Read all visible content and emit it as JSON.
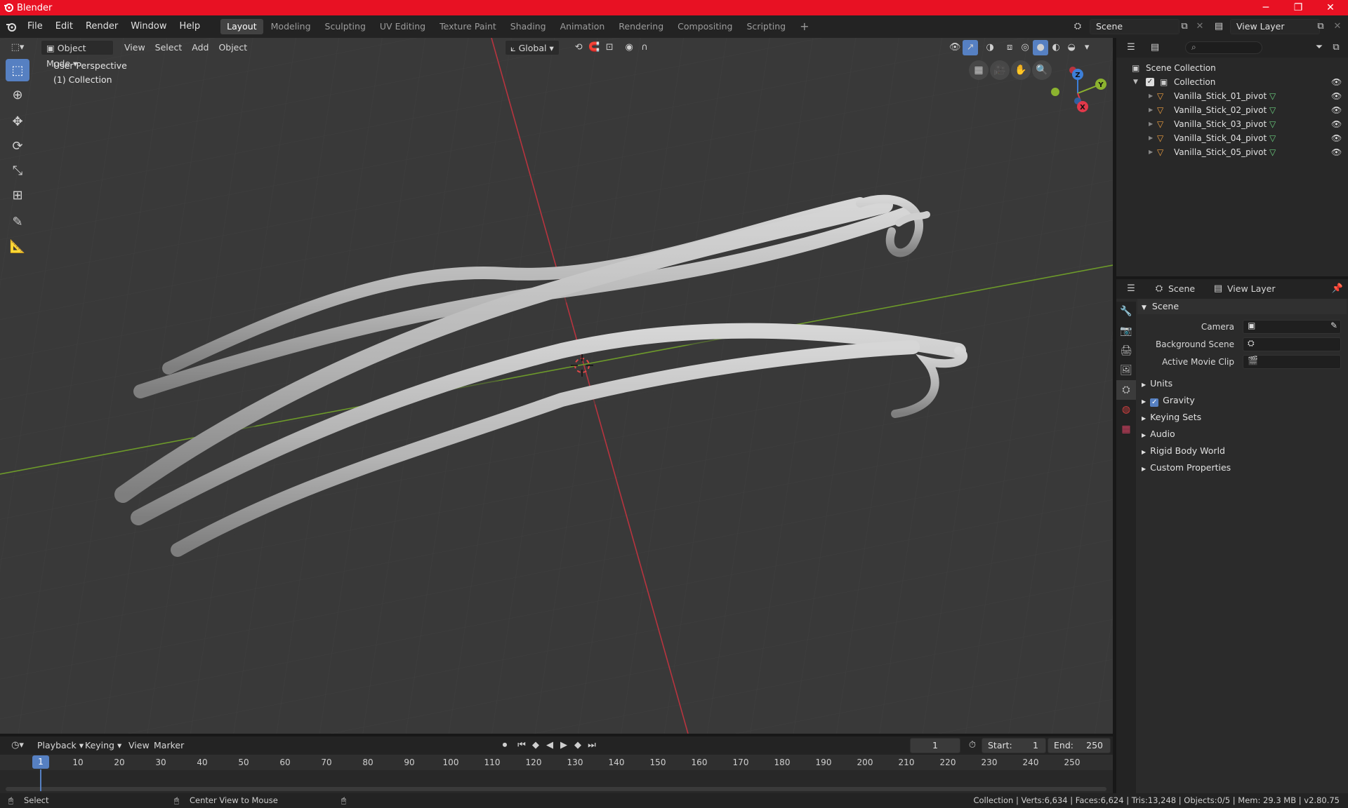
{
  "app": {
    "title": "Blender"
  },
  "menus": [
    "File",
    "Edit",
    "Render",
    "Window",
    "Help"
  ],
  "workspaces": [
    "Layout",
    "Modeling",
    "Sculpting",
    "UV Editing",
    "Texture Paint",
    "Shading",
    "Animation",
    "Rendering",
    "Compositing",
    "Scripting"
  ],
  "active_workspace": "Layout",
  "scene_selector": {
    "value": "Scene"
  },
  "view_layer_selector": {
    "value": "View Layer"
  },
  "viewport": {
    "mode": "Object Mode",
    "menus": [
      "View",
      "Select",
      "Add",
      "Object"
    ],
    "transform_orientation": "Global",
    "info_line1": "User Perspective",
    "info_line2": "(1) Collection",
    "gizmo_axes": {
      "x": "X",
      "y": "Y",
      "z": "Z"
    }
  },
  "outliner": {
    "scene_collection": "Scene Collection",
    "collection": "Collection",
    "objects": [
      "Vanilla_Stick_01_pivot",
      "Vanilla_Stick_02_pivot",
      "Vanilla_Stick_03_pivot",
      "Vanilla_Stick_04_pivot",
      "Vanilla_Stick_05_pivot"
    ]
  },
  "properties": {
    "tab_scene": "Scene",
    "tab_view_layer": "View Layer",
    "section_scene": "Scene",
    "camera_label": "Camera",
    "background_scene_label": "Background Scene",
    "active_movie_clip_label": "Active Movie Clip",
    "panels": [
      "Units",
      "Gravity",
      "Keying Sets",
      "Audio",
      "Rigid Body World",
      "Custom Properties"
    ]
  },
  "timeline": {
    "menus": [
      "Playback",
      "Keying",
      "View",
      "Marker"
    ],
    "current_frame": "1",
    "start_label": "Start:",
    "start_value": "1",
    "end_label": "End:",
    "end_value": "250",
    "ticks": [
      "10",
      "20",
      "30",
      "40",
      "50",
      "60",
      "70",
      "80",
      "90",
      "100",
      "110",
      "120",
      "130",
      "140",
      "150",
      "160",
      "170",
      "180",
      "190",
      "200",
      "210",
      "220",
      "230",
      "240",
      "250"
    ],
    "playhead": "1"
  },
  "statusbar": {
    "left": "Select",
    "middle": "Center View to Mouse",
    "right": "Collection | Verts:6,634 | Faces:6,624 | Tris:13,248 | Objects:0/5 | Mem: 29.3 MB | v2.80.75"
  },
  "colors": {
    "titlebar": "#e81123",
    "accent": "#5680c2",
    "x_axis": "#e0384a",
    "y_axis": "#8cb32f",
    "z_axis": "#3d7fd8"
  }
}
